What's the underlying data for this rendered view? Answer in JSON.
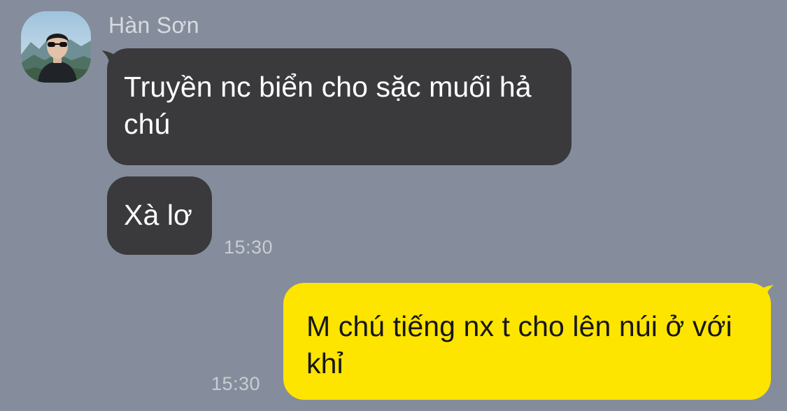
{
  "contact": {
    "name": "Hàn Sơn",
    "avatar": "avatar-photo"
  },
  "messages": [
    {
      "direction": "incoming",
      "text": "Truyền nc biển cho sặc muối hả chú"
    },
    {
      "direction": "incoming",
      "text": "Xà lơ",
      "time": "15:30"
    },
    {
      "direction": "outgoing",
      "text": "M chú tiếng nx t cho lên núi ở với khỉ",
      "time": "15:30"
    }
  ],
  "colors": {
    "background": "#858d9c",
    "incoming_bubble": "#3a3a3d",
    "outgoing_bubble": "#fee500"
  }
}
